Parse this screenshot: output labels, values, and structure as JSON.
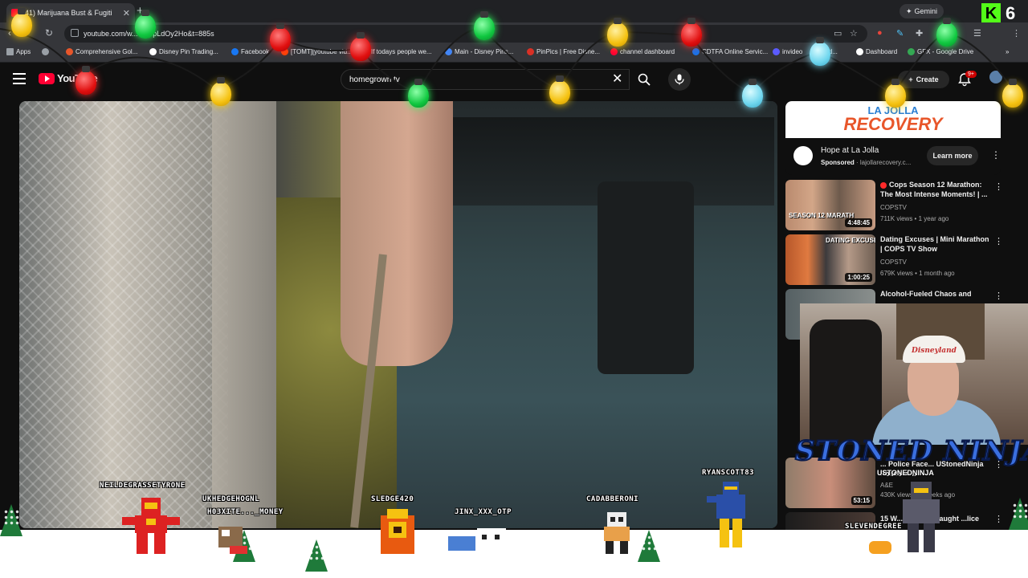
{
  "browser": {
    "tab_title": "(41) Marijuana Bust & Fugiti",
    "url": "youtube.com/w...=ccJpLdOy2Ho&t=885s",
    "gemini_label": "Gemini",
    "kick_count": "6",
    "bookmarks": [
      {
        "label": "Apps",
        "color": "#9aa0a6"
      },
      {
        "label": "Comprehensive Gol...",
        "color": "#e8562a"
      },
      {
        "label": "Disney Pin Trading...",
        "color": "#ffffff"
      },
      {
        "label": "Facebook",
        "color": "#1877f2"
      },
      {
        "label": "[TOMT][youtube vid...",
        "color": "#ff4500"
      },
      {
        "label": "If todays people we...",
        "color": "#ff4500"
      },
      {
        "label": "Main - Disney Pins...",
        "color": "#4285f4"
      },
      {
        "label": "PinPics | Free Disne...",
        "color": "#d93025"
      },
      {
        "label": "channel dashboard",
        "color": "#ff0033"
      },
      {
        "label": "CDTFA Online Servic...",
        "color": "#1a73e8"
      },
      {
        "label": "invideo",
        "color": "#5b5bff"
      },
      {
        "label": "id...",
        "color": "#9aa0a6"
      },
      {
        "label": "Dashboard",
        "color": "#ffffff"
      },
      {
        "label": "GFX - Google Drive",
        "color": "#34a853"
      }
    ]
  },
  "youtube": {
    "logo_text": "YouTube",
    "search_value": "homegrown tv",
    "create_label": "Create",
    "notification_badge": "9+"
  },
  "ad": {
    "banner_line1": "LA JOLLA",
    "banner_line2": "RECOVERY",
    "title": "Hope at La Jolla",
    "sponsored": "Sponsored",
    "domain": "lajollarecovery.c...",
    "cta": "Learn more"
  },
  "recommendations": [
    {
      "title": "Cops Season 12 Marathon: The Most Intense Moments! | ...",
      "channel": "COPSTV",
      "meta": "711K views • 1 year ago",
      "duration": "4:48:45",
      "thumb_text": "SEASON 12 MARATH",
      "live": true
    },
    {
      "title": "Dating Excuses | Mini Marathon | COPS TV Show",
      "channel": "COPSTV",
      "meta": "679K views • 1 month ago",
      "duration": "1:00:25",
      "thumb_text": "DATING EXCUSES",
      "live": false
    },
    {
      "title": "Alcohol-Fueled Chaos and",
      "channel": "",
      "meta": "",
      "duration": "",
      "thumb_text": "",
      "live": false
    },
    {
      "title": "... Police Face... UStonedNinja Police in ...",
      "channel": "A&E",
      "meta": "430K views • 3 weeks ago",
      "duration": "53:15",
      "thumb_text": "",
      "live": false
    },
    {
      "title": "15 W... ...ments Caught ...lice",
      "channel": "",
      "meta": "",
      "duration": "",
      "thumb_text": "",
      "live": false
    }
  ],
  "overlay": {
    "stream_name": "STONED NINJA",
    "ninja_user": "USTONEDNINJA",
    "viewers": [
      {
        "name": "NEILDEGRASSETYRONE"
      },
      {
        "name": "UKHEDGEHOGNL"
      },
      {
        "name": "H03XITE..._MONEY"
      },
      {
        "name": "SLEDGE420"
      },
      {
        "name": "JINX_XXX_OTP"
      },
      {
        "name": "CADABBERONI"
      },
      {
        "name": "RYANSCOTT83"
      },
      {
        "name": "SLEVENDEGREE"
      }
    ]
  }
}
